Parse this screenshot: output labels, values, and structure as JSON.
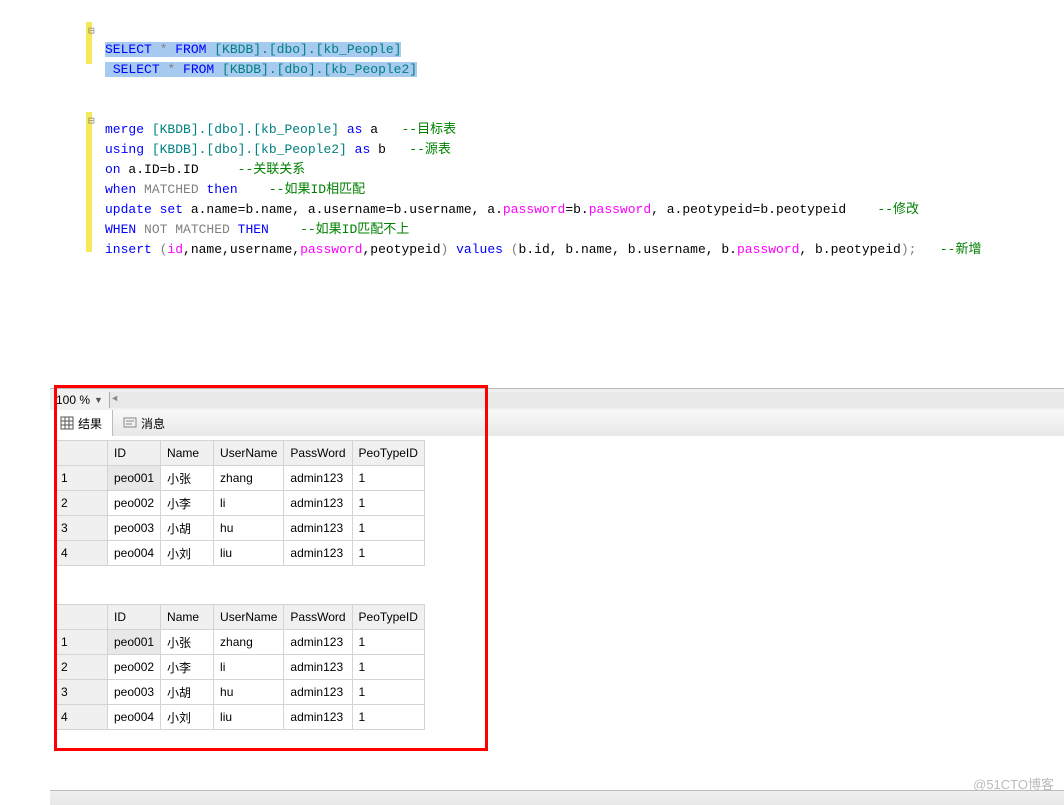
{
  "code": {
    "line1": {
      "pre": "SELECT",
      "star": " * ",
      "from": "FROM",
      "tbl": " [KBDB].[dbo].[kb_People]"
    },
    "line2": {
      "pre": "SELECT",
      "star": " * ",
      "from": "FROM",
      "tbl": " [KBDB].[dbo].[kb_People2]"
    },
    "line5": {
      "merge": "merge",
      "tbl": " [KBDB].[dbo].[kb_People]",
      "as": " as",
      "alias": " a   ",
      "cmt": "--目标表"
    },
    "line6": {
      "using": "using",
      "tbl": " [KBDB].[dbo].[kb_People2]",
      "as": " as",
      "alias": " b   ",
      "cmt": "--源表"
    },
    "line7": {
      "on": "on",
      "expr": " a.ID=b.ID     ",
      "cmt": "--关联关系"
    },
    "line8": {
      "when": "when",
      "matched": " MATCHED ",
      "then": "then",
      "sp": "    ",
      "cmt": "--如果ID相匹配"
    },
    "line9": {
      "update": "update",
      "set": " set",
      "p1": " a.name=b.name, a.username=b.username, a.",
      "f1": "password",
      "eq1": "=b.",
      "f2": "password",
      "p2": ", a.peotypeid=b.peotypeid    ",
      "cmt": "--修改"
    },
    "line10": {
      "when": "WHEN",
      "nm": " NOT MATCHED ",
      "then": "THEN",
      "sp": "    ",
      "cmt": "--如果ID匹配不上"
    },
    "line11": {
      "insert": "insert",
      "lp": " (",
      "f1": "id",
      "c1": ",name,username,",
      "f2": "password",
      "c2": ",peotypeid",
      "rp": ")",
      "values": " values ",
      "lp2": "(",
      "v": "b.id, b.name, b.username, b.",
      "f3": "password",
      "v2": ", b.peotypeid",
      "rp2": ");   ",
      "cmt": "--新增"
    }
  },
  "zoom": "100 %",
  "tabs": {
    "results": "结果",
    "messages": "消息"
  },
  "table": {
    "headers": [
      "ID",
      "Name",
      "UserName",
      "PassWord",
      "PeoTypeID"
    ],
    "rows": [
      [
        "1",
        "peo001",
        "小张",
        "zhang",
        "admin123",
        "1"
      ],
      [
        "2",
        "peo002",
        "小李",
        "li",
        "admin123",
        "1"
      ],
      [
        "3",
        "peo003",
        "小胡",
        "hu",
        "admin123",
        "1"
      ],
      [
        "4",
        "peo004",
        "小刘",
        "liu",
        "admin123",
        "1"
      ]
    ]
  },
  "watermark": "@51CTO博客"
}
